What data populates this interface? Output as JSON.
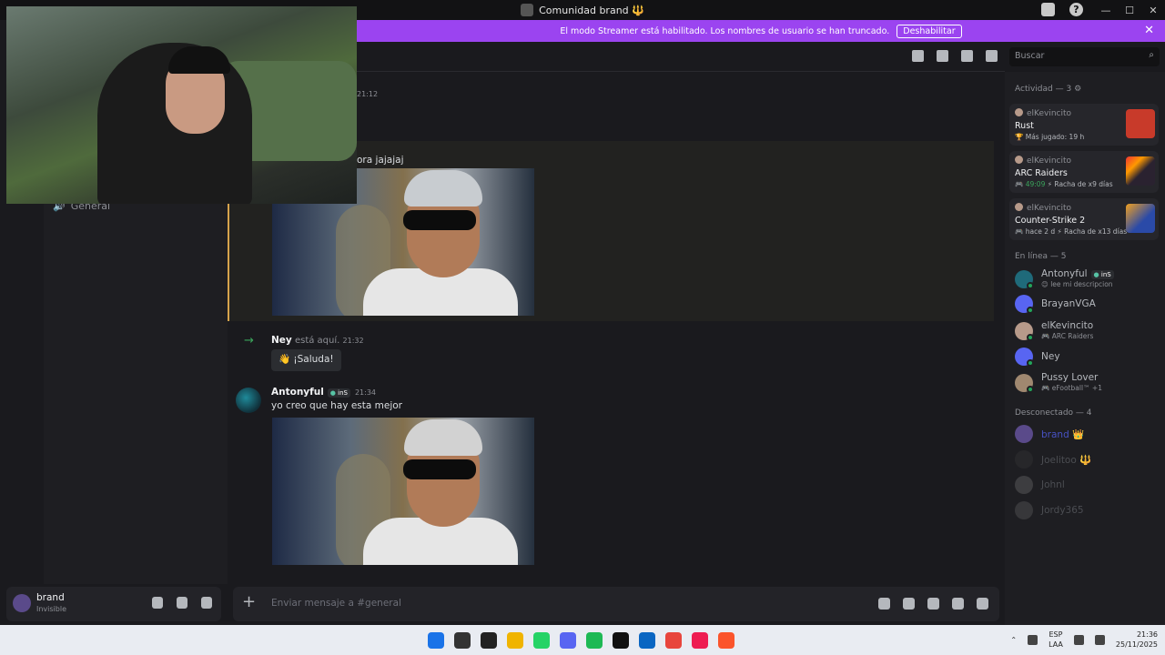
{
  "window": {
    "title": "Comunidad brand 🔱",
    "controls": [
      "—",
      "☐",
      "✕"
    ]
  },
  "banner": {
    "text": "El modo Streamer está habilitado. Los nombres de usuario se han truncado.",
    "button_label": "Deshabilitar",
    "close": "✕"
  },
  "header": {
    "search_placeholder": "Buscar"
  },
  "channels": {
    "voice": "General"
  },
  "messages": {
    "top_timestamp": "21:12",
    "highlight_text": "ora jajajaj",
    "join": {
      "name": "Ney",
      "text": "está aquí.",
      "time": "21:32",
      "wave_label": "¡Saluda!"
    },
    "post": {
      "name": "Antonyful",
      "tag": "inS",
      "time": "21:34",
      "text": "yo creo que hay esta mejor"
    },
    "input_placeholder": "Enviar mensaje a #general"
  },
  "user_panel": {
    "name": "brand",
    "status": "Invisible"
  },
  "members": {
    "activity_title": "Actividad — 3",
    "activities": [
      {
        "user": "elKevincito",
        "game": "Rust",
        "detail": "Más jugado: 19 h",
        "detail_icon": "🏆",
        "color": "#c83a2a"
      },
      {
        "user": "elKevincito",
        "game": "ARC Raiders",
        "time": "49:09",
        "detail": "Racha de x9 días",
        "color": "#2a2230"
      },
      {
        "user": "elKevincito",
        "game": "Counter-Strike 2",
        "time": "hace 2 d",
        "detail": "Racha de x13 días",
        "color": "#2a4aa8"
      }
    ],
    "online_title": "En línea — 5",
    "online": [
      {
        "name": "Antonyful",
        "tag": "inS",
        "sub": "😊 lee mi descripcion",
        "color": "#1f6a7a"
      },
      {
        "name": "BrayanVGA",
        "sub": "",
        "color": "#5865f2"
      },
      {
        "name": "elKevincito",
        "sub": "🎮 ARC Raiders",
        "color": "#b79a8a"
      },
      {
        "name": "Ney",
        "sub": "",
        "color": "#5865f2"
      },
      {
        "name": "Pussy Lover",
        "sub": "🎮 eFootball™ +1",
        "color": "#a08870"
      }
    ],
    "offline_title": "Desconectado — 4",
    "offline": [
      {
        "name": "brand",
        "extra": "👑",
        "color": "#5a4a8a"
      },
      {
        "name": "Joelitoo",
        "extra": "🔱",
        "color": "#3a3a3a"
      },
      {
        "name": "Johnl",
        "extra": "",
        "color": "#777"
      },
      {
        "name": "Jordy365",
        "extra": "",
        "color": "#666"
      }
    ]
  },
  "taskbar": {
    "lang_top": "ESP",
    "lang_bottom": "LAA",
    "time": "21:36",
    "date": "25/11/2025",
    "apps": [
      {
        "name": "windows-start",
        "color": "#1a73e8"
      },
      {
        "name": "search",
        "color": "#333"
      },
      {
        "name": "app-dark",
        "color": "#222"
      },
      {
        "name": "file-explorer",
        "color": "#f0b400"
      },
      {
        "name": "whatsapp",
        "color": "#25d366"
      },
      {
        "name": "discord",
        "color": "#5865f2"
      },
      {
        "name": "spotify",
        "color": "#1db954"
      },
      {
        "name": "capcut",
        "color": "#111"
      },
      {
        "name": "store",
        "color": "#0a66c2"
      },
      {
        "name": "chrome",
        "color": "#e8453c"
      },
      {
        "name": "tiktok",
        "color": "#ee1d52"
      },
      {
        "name": "brave",
        "color": "#fb542b"
      }
    ]
  }
}
